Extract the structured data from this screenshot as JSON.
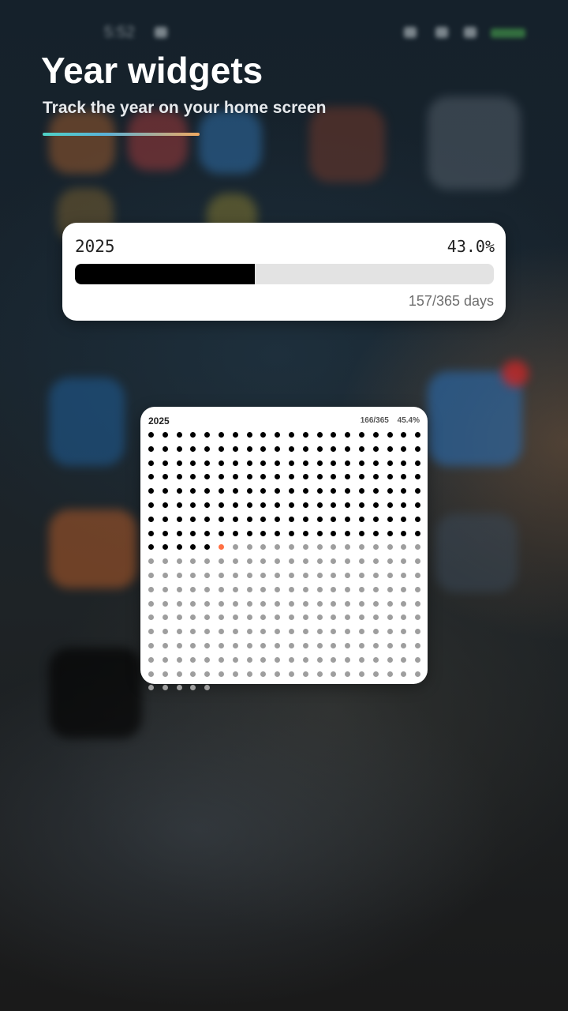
{
  "header": {
    "title": "Year widgets",
    "subtitle": "Track the year on your home screen"
  },
  "status_bar": {
    "time": "5:52"
  },
  "progress_widget": {
    "year": "2025",
    "percent_label": "43.0%",
    "progress_fraction": 0.43,
    "days_label": "157/365 days"
  },
  "dot_widget": {
    "year": "2025",
    "count_label": "166/365",
    "percent_label": "45.4%",
    "days_in_year": 365,
    "days_elapsed": 166,
    "columns": 20
  },
  "colors": {
    "accent_gradient": [
      "#4fd1c5",
      "#5ab2d8",
      "#f0a860"
    ],
    "dot_past": "#000000",
    "dot_today": "#ff7043",
    "dot_future": "#9e9e9e",
    "bar_fill": "#000000",
    "bar_track": "#e3e3e3"
  }
}
